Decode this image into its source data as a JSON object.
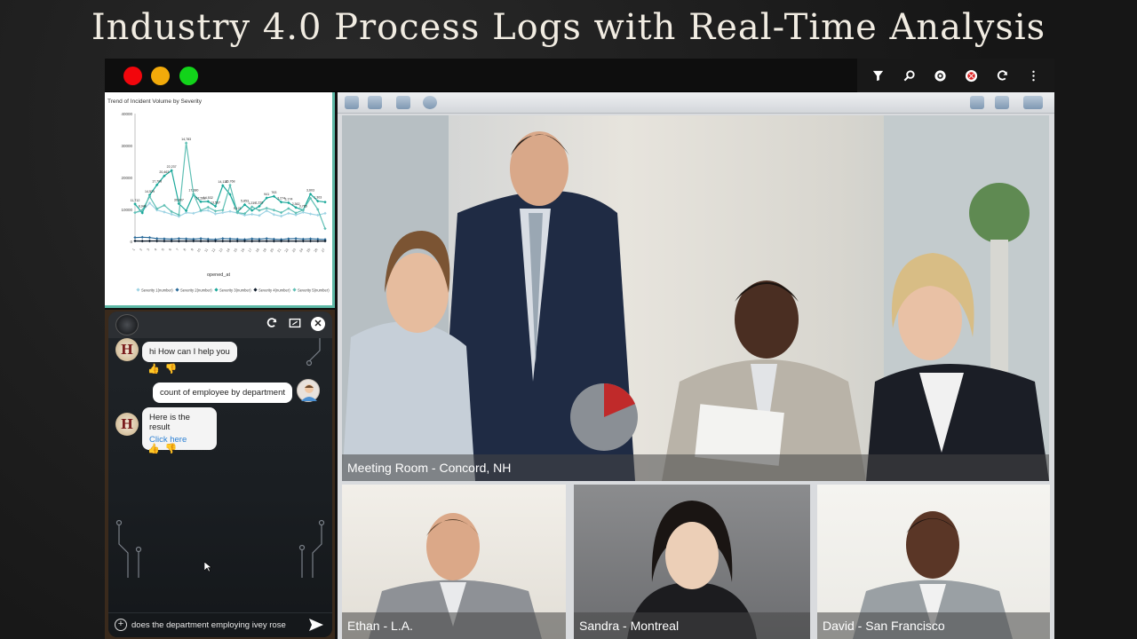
{
  "slide": {
    "title": "Industry 4.0 Process Logs with Real-Time Analysis"
  },
  "window": {
    "toolbar": {
      "icons": [
        "filter-icon",
        "search-icon",
        "settings-icon",
        "record-icon",
        "refresh-icon",
        "more-icon"
      ]
    }
  },
  "chart_data": {
    "type": "line",
    "title": "Trend of Incident Volume by Severity",
    "xlabel": "opened_at",
    "ylabel": "",
    "ylim": [
      0,
      40000
    ],
    "yticks": [
      0,
      10000,
      20000,
      30000,
      40000
    ],
    "x": [
      "1",
      "2",
      "3",
      "4",
      "5",
      "6",
      "7",
      "8",
      "9",
      "10",
      "11",
      "12",
      "13",
      "14",
      "15",
      "16",
      "17",
      "18",
      "19",
      "20",
      "21",
      "22",
      "23",
      "24",
      "25",
      "26",
      "27"
    ],
    "series": [
      {
        "name": "Severity 1(number)",
        "color": "#9fd4e4",
        "values": [
          9000,
          9500,
          12000,
          9800,
          9200,
          8500,
          7800,
          9000,
          8800,
          9500,
          9700,
          8600,
          9000,
          9400,
          8900,
          8200,
          8500,
          8100,
          9600,
          8400,
          7900,
          8800,
          8300,
          9100,
          8600,
          8200,
          8800
        ]
      },
      {
        "name": "Severity 2(number)",
        "color": "#2a6b9a",
        "values": [
          1200,
          1300,
          1200,
          900,
          800,
          700,
          900,
          800,
          700,
          900,
          700,
          600,
          900,
          800,
          700,
          600,
          800,
          700,
          900,
          700,
          600,
          800,
          900,
          700,
          800,
          700,
          600
        ]
      },
      {
        "name": "Severity 3(number)",
        "color": "#1aa89a",
        "values": [
          11700,
          8900,
          14500,
          17700,
          20500,
          22200,
          11800,
          9600,
          14700,
          12400,
          12500,
          11000,
          17500,
          14700,
          9200,
          11500,
          9700,
          11000,
          13600,
          14100,
          12300,
          12100,
          10600,
          9800,
          14800,
          12600,
          12300
        ]
      },
      {
        "name": "Severity 4(number)",
        "color": "#0d1b2a",
        "values": [
          150,
          120,
          140,
          130,
          120,
          110,
          100,
          120,
          130,
          110,
          100,
          120,
          110,
          100,
          120,
          110,
          100,
          120,
          110,
          100,
          120,
          110,
          100,
          120,
          110,
          100,
          120
        ]
      },
      {
        "name": "Severity 5(number)",
        "color": "#5fbfb4",
        "values": [
          9000,
          9800,
          14000,
          10200,
          11300,
          9300,
          8300,
          30800,
          14800,
          9700,
          10700,
          9500,
          9800,
          17600,
          9000,
          8700,
          10800,
          9700,
          10400,
          9800,
          9000,
          10300,
          8900,
          9800,
          13500,
          10000,
          4000
        ]
      }
    ],
    "annotations": [
      "11,712",
      "8,946",
      "14,529",
      "17,708",
      "20,463",
      "22,237",
      "30,807",
      "14,783",
      "17,380",
      "17,563",
      "14,532",
      "13,567",
      "14,118",
      "15,768",
      "9,121",
      "5,853",
      "1,239",
      "1,226",
      "941",
      "763",
      "3,274",
      "3,174",
      "2,362",
      "3,765",
      "3,603",
      "1,303"
    ],
    "grid": false,
    "legend": "bottom"
  },
  "chat": {
    "messages": [
      {
        "from": "bot",
        "text": "hi How can I help you"
      },
      {
        "from": "user",
        "text": "count of employee by department"
      },
      {
        "from": "bot",
        "text": "Here is the result",
        "link": "Click here"
      }
    ],
    "input_value": "does the department employing ivey rose",
    "bot_avatar_letter": "H"
  },
  "video": {
    "main_label": "Meeting Room - Concord, NH",
    "thumbs": [
      {
        "label": "Ethan - L.A."
      },
      {
        "label": "Sandra - Montreal"
      },
      {
        "label": "David - San Francisco"
      }
    ]
  },
  "colors": {
    "accent_teal": "#5db8a6",
    "close_red": "#f2060c",
    "minimize_yellow": "#f2aa0a",
    "maximize_green": "#12d41a"
  }
}
